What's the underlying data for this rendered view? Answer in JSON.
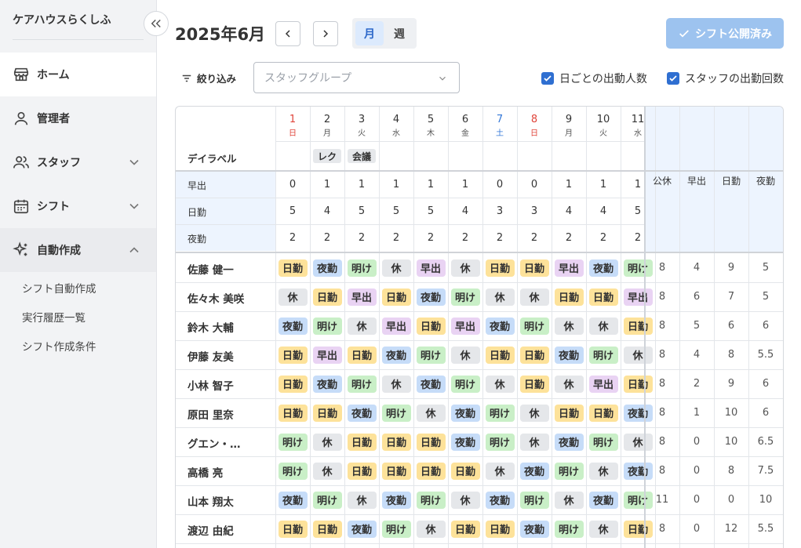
{
  "sidebar": {
    "facility_name": "ケアハウスらくしふ",
    "nav": [
      {
        "key": "home",
        "label": "ホーム"
      },
      {
        "key": "admin",
        "label": "管理者"
      },
      {
        "key": "staff",
        "label": "スタッフ"
      },
      {
        "key": "shift",
        "label": "シフト"
      },
      {
        "key": "auto",
        "label": "自動作成"
      }
    ],
    "auto_sub": [
      "シフト自動作成",
      "実行履歴一覧",
      "シフト作成条件"
    ]
  },
  "header": {
    "month_title": "2025年6月",
    "view_month": "月",
    "view_week": "週",
    "publish_label": "シフト公開済み"
  },
  "filters": {
    "filter_label": "絞り込み",
    "group_placeholder": "スタッフグループ",
    "check_daily": "日ごとの出動人数",
    "check_staff": "スタッフの出勤回数"
  },
  "colors": {
    "accent": "#2f6fd1",
    "publish": "#9dc3ef",
    "sunday": "#e0443a",
    "saturday": "#3478d8"
  },
  "grid": {
    "days": [
      {
        "num": "1",
        "wd": "日",
        "type": "sun"
      },
      {
        "num": "2",
        "wd": "月",
        "type": ""
      },
      {
        "num": "3",
        "wd": "火",
        "type": ""
      },
      {
        "num": "4",
        "wd": "水",
        "type": ""
      },
      {
        "num": "5",
        "wd": "木",
        "type": ""
      },
      {
        "num": "6",
        "wd": "金",
        "type": ""
      },
      {
        "num": "7",
        "wd": "土",
        "type": "sat"
      },
      {
        "num": "8",
        "wd": "日",
        "type": "sun"
      },
      {
        "num": "9",
        "wd": "月",
        "type": ""
      },
      {
        "num": "10",
        "wd": "火",
        "type": ""
      },
      {
        "num": "11",
        "wd": "水",
        "type": ""
      }
    ],
    "day_label_header": "デイラベル",
    "day_labels": [
      "",
      "レク",
      "会議",
      "",
      "",
      "",
      "",
      "",
      "",
      "",
      ""
    ],
    "counts": [
      {
        "label": "早出",
        "values": [
          "0",
          "1",
          "1",
          "1",
          "1",
          "1",
          "0",
          "0",
          "1",
          "1",
          "1"
        ]
      },
      {
        "label": "日勤",
        "values": [
          "5",
          "4",
          "5",
          "5",
          "5",
          "4",
          "3",
          "3",
          "4",
          "4",
          "5"
        ]
      },
      {
        "label": "夜勤",
        "values": [
          "2",
          "2",
          "2",
          "2",
          "2",
          "2",
          "2",
          "2",
          "2",
          "2",
          "2"
        ]
      }
    ],
    "summary_headers": [
      "公休",
      "早出",
      "日勤",
      "夜勤"
    ],
    "staff": [
      {
        "name": "佐藤 健一",
        "shifts": [
          "日勤",
          "夜勤",
          "明け",
          "休",
          "早出",
          "休",
          "日勤",
          "日勤",
          "早出",
          "夜勤",
          "明け"
        ],
        "summary": [
          "8",
          "4",
          "9",
          "5"
        ]
      },
      {
        "name": "佐々木 美咲",
        "shifts": [
          "休",
          "日勤",
          "早出",
          "日勤",
          "夜勤",
          "明け",
          "休",
          "休",
          "日勤",
          "日勤",
          "早出"
        ],
        "summary": [
          "8",
          "6",
          "7",
          "5"
        ]
      },
      {
        "name": "鈴木 大輔",
        "shifts": [
          "夜勤",
          "明け",
          "休",
          "早出",
          "日勤",
          "早出",
          "夜勤",
          "明け",
          "休",
          "休",
          "日勤"
        ],
        "summary": [
          "8",
          "5",
          "6",
          "6"
        ]
      },
      {
        "name": "伊藤 友美",
        "shifts": [
          "日勤",
          "早出",
          "日勤",
          "夜勤",
          "明け",
          "休",
          "日勤",
          "日勤",
          "夜勤",
          "明け",
          "休"
        ],
        "summary": [
          "8",
          "4",
          "8",
          "5.5"
        ]
      },
      {
        "name": "小林 智子",
        "shifts": [
          "日勤",
          "夜勤",
          "明け",
          "休",
          "夜勤",
          "明け",
          "休",
          "日勤",
          "休",
          "早出",
          "日勤"
        ],
        "summary": [
          "8",
          "2",
          "9",
          "6"
        ]
      },
      {
        "name": "原田 里奈",
        "shifts": [
          "日勤",
          "日勤",
          "夜勤",
          "明け",
          "休",
          "夜勤",
          "明け",
          "休",
          "日勤",
          "日勤",
          "夜勤"
        ],
        "summary": [
          "8",
          "1",
          "10",
          "6"
        ]
      },
      {
        "name": "グエン・…",
        "shifts": [
          "明け",
          "休",
          "日勤",
          "日勤",
          "日勤",
          "夜勤",
          "明け",
          "休",
          "夜勤",
          "明け",
          "休"
        ],
        "summary": [
          "8",
          "0",
          "10",
          "6.5"
        ]
      },
      {
        "name": "高橋 亮",
        "shifts": [
          "明け",
          "休",
          "日勤",
          "日勤",
          "日勤",
          "日勤",
          "休",
          "夜勤",
          "明け",
          "休",
          "夜勤"
        ],
        "summary": [
          "8",
          "0",
          "8",
          "7.5"
        ]
      },
      {
        "name": "山本 翔太",
        "shifts": [
          "夜勤",
          "明け",
          "休",
          "夜勤",
          "明け",
          "休",
          "夜勤",
          "明け",
          "休",
          "夜勤",
          "明け"
        ],
        "summary": [
          "11",
          "0",
          "0",
          "10"
        ]
      },
      {
        "name": "渡辺 由紀",
        "shifts": [
          "日勤",
          "日勤",
          "夜勤",
          "明け",
          "休",
          "日勤",
          "日勤",
          "夜勤",
          "明け",
          "休",
          "日勤"
        ],
        "summary": [
          "8",
          "0",
          "12",
          "5.5"
        ]
      }
    ]
  }
}
